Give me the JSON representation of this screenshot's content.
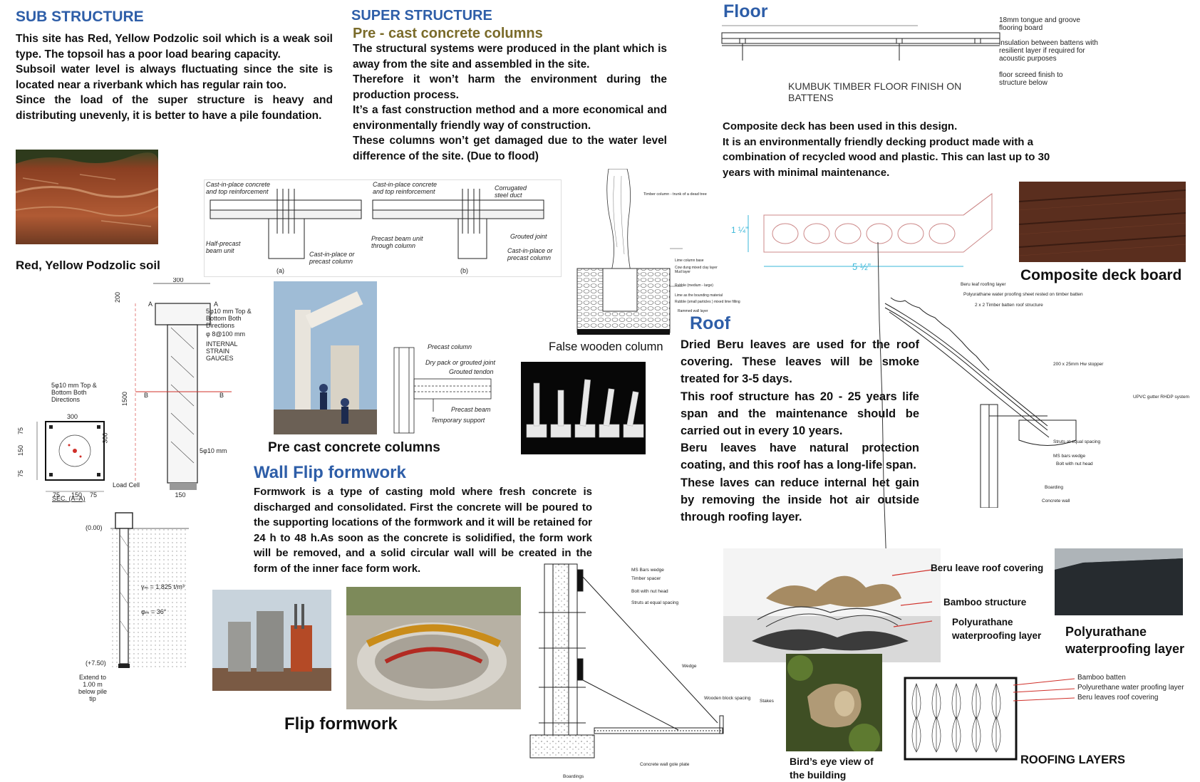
{
  "sub": {
    "heading": "SUB STRUCTURE",
    "paragraphs": [
      "This site has Red, Yellow Podzolic soil which is a weak soil type. The topsoil has a poor load bearing capacity.",
      "Subsoil water level is always fluctuating since the site is located near a riverbank which has regular rain too.",
      "Since the load of the super structure is heavy and distributing unevenly, it is better to have a pile foundation."
    ],
    "soil_caption": "Red, Yellow Podzolic soil",
    "pile": {
      "dim_300_top": "300",
      "dim_200": "200",
      "dim_1500": "1500",
      "dim_150_bottom": "150",
      "note_bars": "5φ10 mm Top & Bottom Both Directions",
      "note_stirrup": "φ 8@100 mm",
      "note_strain": "INTERNAL STRAIN GAUGES",
      "note_5phi": "5φ10 mm",
      "load_cell": "Load Cell",
      "sec_label": "SEC. (A–A)",
      "sec_note": "5φ10 mm Top & Bottom Both Directions",
      "sec_300": "300",
      "sec_300_side": "300",
      "sec_75a": "75",
      "sec_150": "150",
      "sec_75b": "75",
      "sec_v75a": "75",
      "sec_v150": "150",
      "sec_v75b": "75",
      "a_label": "A",
      "b_label": "B",
      "level_top": "(0.00)",
      "level_bot": "(+7.50)",
      "gamma": "γₘ = 1.825 t/m³",
      "phi": "φₘ = 36°",
      "extend": "Extend to 1.00 m below pile tip"
    }
  },
  "super": {
    "heading": "SUPER STRUCTURE",
    "subheading": "Pre - cast concrete columns",
    "paragraphs": [
      "The structural systems were produced in the plant which is away from the site and assembled in the site.",
      "Therefore it won’t harm the environment during the production process.",
      "It’s a fast construction method and a more economical and environmentally friendly way of construction.",
      "These columns won’t get damaged due to the water level difference of the site. (Due to flood)"
    ],
    "detail_a": {
      "l1": "Cast-in-place concrete and top reinforcement",
      "l2": "Half-precast beam unit",
      "l3": "Cast-in-place or precast column",
      "tag": "(a)"
    },
    "detail_b": {
      "l1": "Cast-in-place concrete and top reinforcement",
      "l2": "Corrugated steel duct",
      "l3": "Precast beam unit through column",
      "l4": "Grouted joint",
      "l5": "Cast-in-place or precast column",
      "tag": "(b)"
    },
    "joint": {
      "l1": "Precast column",
      "l2": "Dry pack or grouted joint",
      "l3": "Grouted tendon",
      "l4": "Precast beam",
      "l5": "Temporary support"
    },
    "precast_caption": "Pre cast concrete columns",
    "false_col": {
      "caption": "False wooden column",
      "l1": "Timber column - trunk of a dead tree",
      "l2": "Lime column base",
      "l3": "Cow dung mixed clay layer",
      "l4": "Mud layer",
      "l5": "Rubble (medium - large)",
      "l6": "Lime as the bounding material",
      "l7": "Rubble (small particles ) mixed lime filling",
      "l8": "Rammed wall layer"
    }
  },
  "wall": {
    "heading": "Wall Flip formwork",
    "paragraph": "Formwork is a type of casting mold where fresh concrete is discharged and consolidated. First the concrete will be poured to the supporting locations of the formwork and it will be retained for 24 h to 48 h.As soon as the concrete is solidified, the form work will be removed, and a solid circular wall will be created in the form of the inner face form work.",
    "caption": "Flip formwork",
    "labels": {
      "l1": "MS Bars wedge",
      "l2": "Timber spacer",
      "l3": "Bolt with nut head",
      "l4": "Struts at equal spacing",
      "l5": "Wedge",
      "l6": "Wooden block spacing",
      "l7": "Stakes",
      "l8": "Concrete wall gole plate",
      "l9": "Boardings"
    }
  },
  "floor": {
    "heading": "Floor",
    "detail_title": "KUMBUK TIMBER FLOOR FINISH ON BATTENS",
    "n1": "18mm tongue and groove flooring board",
    "n2": "insulation between battens with resilient layer if required for acoustic purposes",
    "n3": "floor screed finish to structure below",
    "paragraphs": [
      "Composite deck has been used in this design.",
      "It is an environmentally friendly decking product made with a combination of recycled wood and plastic. This can last up to 30 years with minimal maintenance."
    ],
    "deck_caption": "Composite deck board",
    "dim_h": "1 ¼”",
    "dim_w": "5 ½”"
  },
  "roof": {
    "heading": "Roof",
    "paragraphs": [
      "Dried Beru leaves are used for the roof covering. These leaves will be smoke treated for 3-5 days.",
      "This roof structure has 20 - 25 years life span and the maintenance should be carried out in every 10 years.",
      "Beru leaves have natural protection coating, and this roof has a long-life span.",
      "These laves can reduce internal het gain by removing the inside hot air outside through roofing layer."
    ],
    "section": {
      "l1": "Beru leaf roofing layer",
      "l2": "Polyurathane water proofing sheet rested on timber batten",
      "l3": "2 x 2 Timber batten roof structure",
      "l4": "200 x 25mm Hw stopper",
      "l5": "UPVC gutter RHDP system",
      "l6": "Struts at equal spacing",
      "l7": "MS bars wedge",
      "l8": "Bolt with nut head",
      "l9": "Boarding",
      "l10": "Concrete wall"
    },
    "exploded": {
      "l1": "Beru leave roof covering",
      "l2": "Bamboo structure",
      "l3": "Polyurathane waterproofing layer"
    },
    "poly_caption": "Polyurathane waterproofing layer",
    "birds_caption": "Bird’s eye view of the building",
    "layers_caption": "ROOFING LAYERS",
    "layers": {
      "l1": "Bamboo batten",
      "l2": "Polyurethane water proofing layer",
      "l3": "Beru leaves roof covering"
    }
  },
  "colors": {
    "heading_blue": "#2e5ea8",
    "heading_olive": "#7a6b2a",
    "soil": "#9a4a2c",
    "deck": "#5a2e1e",
    "red_dim": "#d0302a"
  }
}
